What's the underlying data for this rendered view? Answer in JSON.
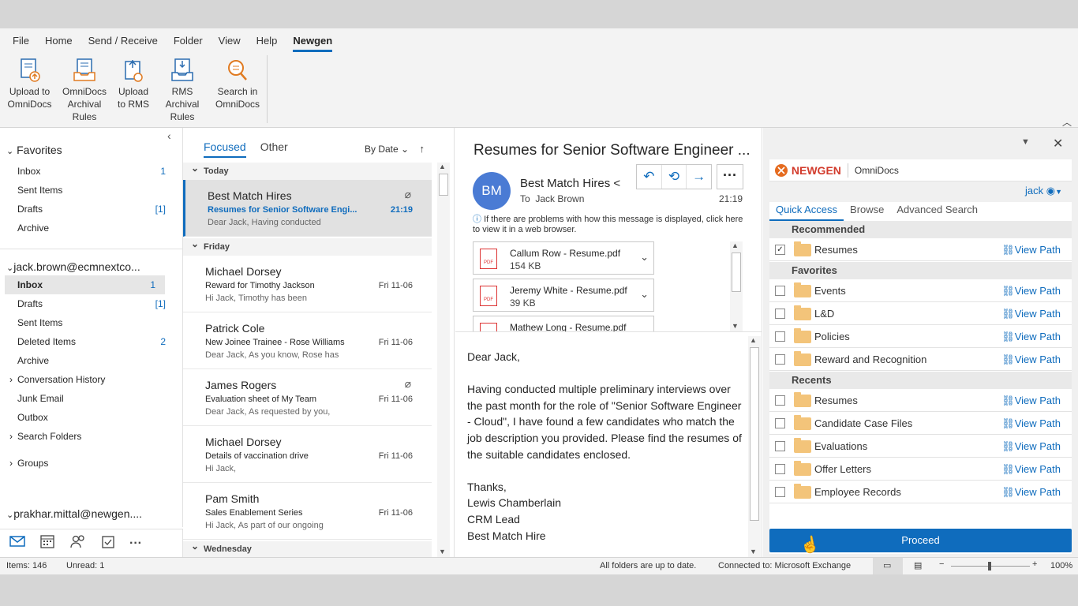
{
  "ribbon": {
    "menu": [
      "File",
      "Home",
      "Send / Receive",
      "Folder",
      "View",
      "Help",
      "Newgen"
    ],
    "buttons": [
      {
        "l1": "Upload to",
        "l2": "OmniDocs",
        "icon": "upload-document-icon"
      },
      {
        "l1": "OmniDocs",
        "l2": "Archival Rules",
        "icon": "archive-rules-icon"
      },
      {
        "l1": "Upload",
        "l2": "to RMS",
        "icon": "upload-rms-icon"
      },
      {
        "l1": "RMS",
        "l2": "Archival Rules",
        "icon": "rms-rules-icon"
      },
      {
        "l1": "Search in",
        "l2": "OmniDocs",
        "icon": "search-omnidocs-icon"
      }
    ]
  },
  "nav": {
    "favorites_header": "Favorites",
    "favorites": [
      {
        "label": "Inbox",
        "count": "1"
      },
      {
        "label": "Sent Items",
        "count": ""
      },
      {
        "label": "Drafts",
        "count": "[1]"
      },
      {
        "label": "Archive",
        "count": ""
      }
    ],
    "account1": "jack.brown@ecmnextco...",
    "account1_items": [
      {
        "label": "Inbox",
        "count": "1"
      },
      {
        "label": "Drafts",
        "count": "[1]"
      },
      {
        "label": "Sent Items",
        "count": ""
      },
      {
        "label": "Deleted Items",
        "count": "2"
      },
      {
        "label": "Archive",
        "count": ""
      },
      {
        "label": "Conversation History",
        "count": ""
      },
      {
        "label": "Junk Email",
        "count": ""
      },
      {
        "label": "Outbox",
        "count": ""
      },
      {
        "label": "Search Folders",
        "count": ""
      }
    ],
    "groups": "Groups",
    "account2": "prakhar.mittal@newgen...."
  },
  "list": {
    "tab_focused": "Focused",
    "tab_other": "Other",
    "sort": "By Date",
    "groups": [
      "Today",
      "Friday",
      "Wednesday"
    ],
    "messages": [
      {
        "from": "Best Match Hires",
        "subject": "Resumes for Senior Software Engi...",
        "preview": "Dear Jack,   Having conducted",
        "time": "21:19",
        "attachment": true
      },
      {
        "from": "Michael Dorsey",
        "subject": "Reward for Timothy Jackson",
        "preview": "Hi Jack,  Timothy has been",
        "time": "Fri 11-06",
        "attachment": false
      },
      {
        "from": "Patrick Cole",
        "subject": "New Joinee Trainee - Rose Williams",
        "preview": "Dear Jack,  As you know, Rose has",
        "time": "Fri 11-06",
        "attachment": false
      },
      {
        "from": "James Rogers",
        "subject": "Evaluation sheet of My Team",
        "preview": "Dear Jack,  As requested by you,",
        "time": "Fri 11-06",
        "attachment": true
      },
      {
        "from": "Michael Dorsey",
        "subject": "Details of vaccination drive",
        "preview": "Hi Jack,",
        "time": "Fri 11-06",
        "attachment": false
      },
      {
        "from": "Pam  Smith",
        "subject": "Sales Enablement Series",
        "preview": "Hi Jack,  As part of our ongoing",
        "time": "Fri 11-06",
        "attachment": false
      }
    ]
  },
  "reading": {
    "title": "Resumes for Senior Software Engineer ...",
    "initials": "BM",
    "sender": "Best Match Hires <",
    "to_label": "To",
    "to": "Jack Brown",
    "time": "21:19",
    "info": "If there are problems with how this message is displayed, click here to view it in a web browser.",
    "attachments": [
      {
        "name": "Callum Row - Resume.pdf",
        "size": "154 KB"
      },
      {
        "name": "Jeremy White - Resume.pdf",
        "size": "39 KB"
      },
      {
        "name": "Mathew Long - Resume.pdf",
        "size": ""
      }
    ],
    "body": [
      "Dear Jack,",
      "",
      "Having conducted multiple preliminary interviews over the past month for the role of \"Senior Software Engineer - Cloud\", I have found a few candidates who match the job description you provided. Please find the resumes of the suitable candidates enclosed.",
      "",
      "Thanks,",
      "Lewis Chamberlain",
      "CRM Lead",
      "Best Match Hire"
    ]
  },
  "omnidocs": {
    "brand": "NEWGEN",
    "app": "OmniDocs",
    "user": "jack",
    "tabs": [
      "Quick Access",
      "Browse",
      "Advanced Search"
    ],
    "view_path": "View Path",
    "recommended_header": "Recommended",
    "recommended": [
      {
        "name": "Resumes",
        "checked": true
      }
    ],
    "favorites_header": "Favorites",
    "favorites": [
      {
        "name": "Events"
      },
      {
        "name": "L&D"
      },
      {
        "name": "Policies"
      },
      {
        "name": "Reward and Recognition"
      }
    ],
    "recents_header": "Recents",
    "recents": [
      {
        "name": "Resumes"
      },
      {
        "name": "Candidate Case Files"
      },
      {
        "name": "Evaluations"
      },
      {
        "name": "Offer Letters"
      },
      {
        "name": "Employee Records"
      }
    ],
    "proceed": "Proceed"
  },
  "status": {
    "items": "Items: 146",
    "unread": "Unread: 1",
    "sync": "All folders are up to date.",
    "connection": "Connected to: Microsoft Exchange",
    "zoom": "100%",
    "zoom_level": 1.0
  },
  "colors": {
    "accent": "#0f6cbd",
    "brand": "#d23b2c",
    "folder": "#f3c47a"
  }
}
